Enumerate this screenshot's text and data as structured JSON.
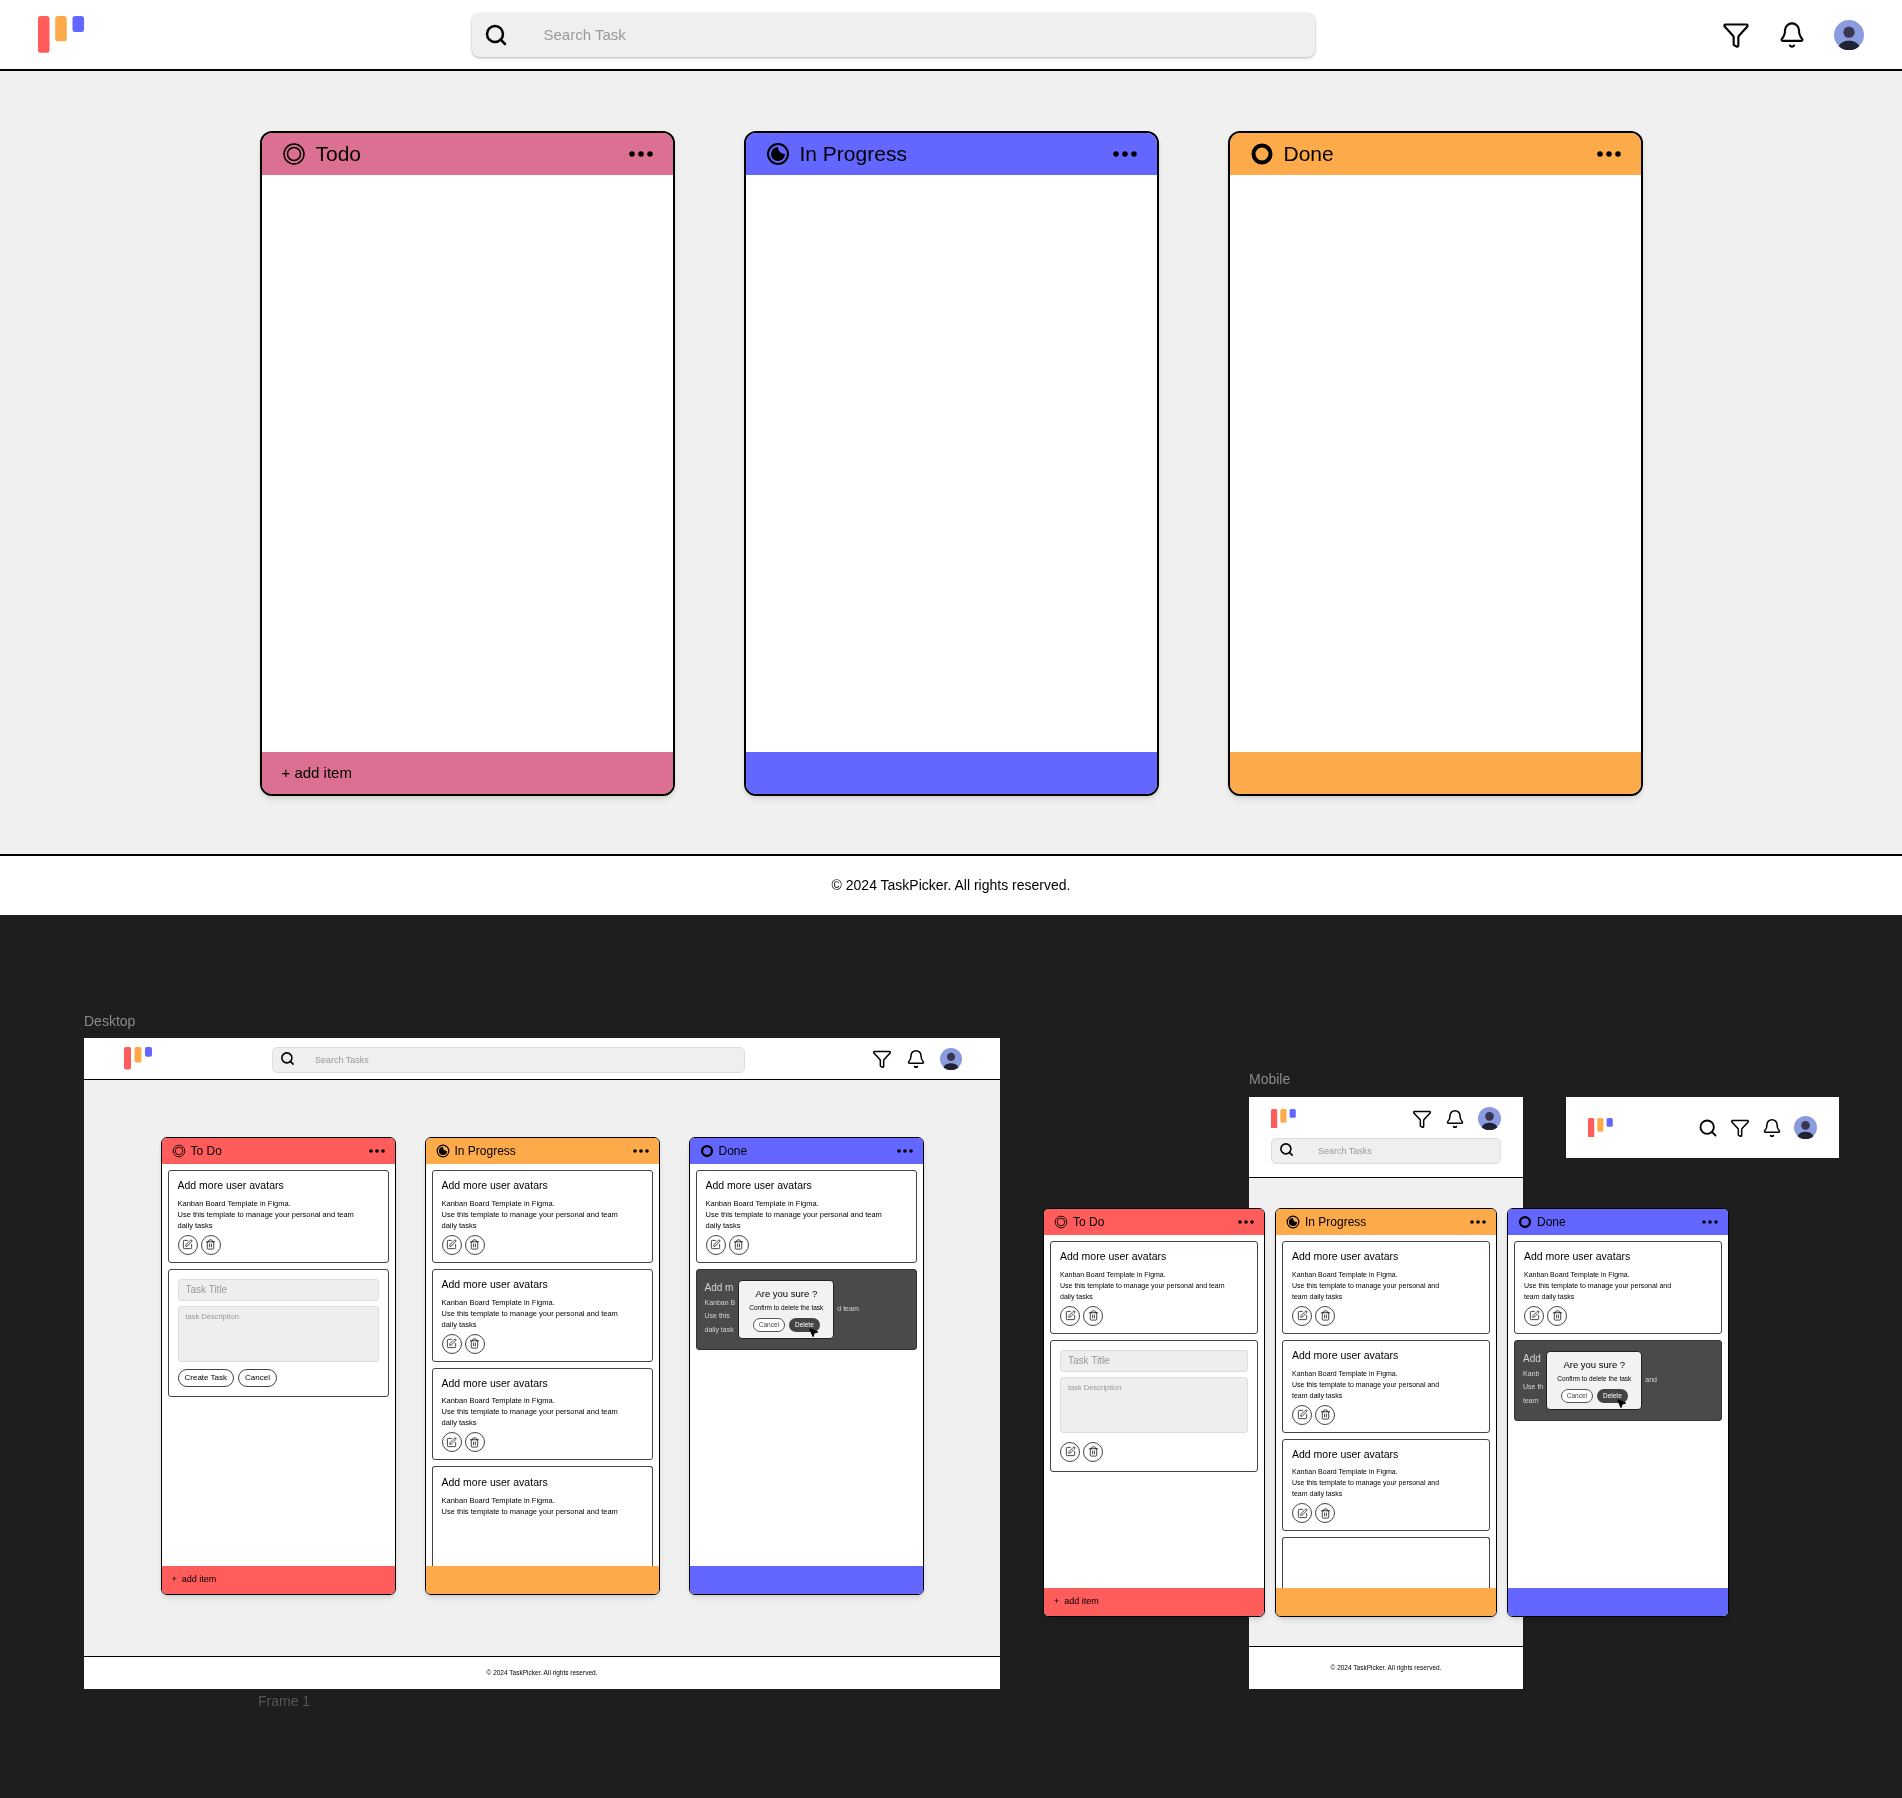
{
  "header": {
    "search_placeholder": "Search Task"
  },
  "board": {
    "columns": [
      {
        "title": "Todo",
        "kind": "ring",
        "color": "#dc7092",
        "footer_text": "+ add item"
      },
      {
        "title": "In Progress",
        "kind": "partial",
        "color": "#6366ff"
      },
      {
        "title": "Done",
        "kind": "solid",
        "color": "#fdaa4a"
      }
    ]
  },
  "footer": {
    "text": "© 2024 TaskPicker. All rights reserved."
  },
  "canvas": {
    "desktop": {
      "label": "Desktop",
      "frame_label": "Frame 1",
      "header": {
        "search_placeholder": "Search Tasks"
      },
      "footer": "© 2024 TaskPicker. All rights reserved.",
      "columns": [
        {
          "title": "To Do",
          "kind": "ring",
          "color": "#ff5c5c",
          "footer_text": "+  add item",
          "items": [
            {
              "kind": "task",
              "title": "Add more user avatars",
              "lines": [
                "Kanban Board Template in Figma.",
                "Use this template to manage your personal and team",
                "daily tasks"
              ],
              "actions": true
            },
            {
              "kind": "form",
              "title_placeholder": "Task Title",
              "description_placeholder": "task Description",
              "buttons": [
                "Create Task",
                "Cancel"
              ],
              "actions": false
            }
          ]
        },
        {
          "title": "In Progress",
          "kind": "partial",
          "color": "#fdaa4a",
          "items": [
            {
              "kind": "task",
              "title": "Add more user avatars",
              "lines": [
                "Kanban Board Template in Figma.",
                "Use this template to manage your personal and team",
                "daily tasks"
              ],
              "actions": true
            },
            {
              "kind": "task",
              "title": "Add more user avatars",
              "lines": [
                "Kanban Board Template in Figma.",
                "Use this template to manage your personal and team",
                "daily tasks"
              ],
              "actions": true
            },
            {
              "kind": "task",
              "title": "Add more user avatars",
              "lines": [
                "Kanban Board Template in Figma.",
                "Use this template to manage your personal and team",
                "daily tasks"
              ],
              "actions": true
            },
            {
              "kind": "partial",
              "title": "Add more user avatars",
              "lines": [
                "Kanban Board Template in Figma.",
                "Use this template to manage your personal and team"
              ]
            }
          ]
        },
        {
          "title": "Done",
          "kind": "solid",
          "color": "#6366ff",
          "items": [
            {
              "kind": "task",
              "title": "Add more user avatars",
              "lines": [
                "Kanban Board Template in Figma.",
                "Use this template to manage your personal and team",
                "daily tasks"
              ],
              "actions": true
            },
            {
              "kind": "confirm",
              "behind_left": [
                "Add m",
                "Kanban B",
                "Use this",
                "daily task"
              ],
              "behind_right": "d team",
              "dialog": {
                "title": "Are you sure ?",
                "message": "Confirm to delete the task",
                "cancel": "Cancel",
                "confirm": "Delete"
              }
            }
          ]
        }
      ]
    },
    "mobile": {
      "label": "Mobile",
      "header": {
        "search_placeholder": "Search Tasks"
      },
      "footer": "© 2024 TaskPicker. All rights reserved.",
      "columns": [
        {
          "title": "To Do",
          "kind": "ring",
          "color": "#ff5c5c",
          "footer_text": "+  add item",
          "items": [
            {
              "kind": "task",
              "title": "Add more user avatars",
              "lines": [
                "Kanban Board Template in Figma.",
                "Use this template to manage your personal and team",
                "daily tasks"
              ],
              "actions": true
            },
            {
              "kind": "form",
              "title_placeholder": "Task Title",
              "description_placeholder": "task Description",
              "actions": true
            }
          ]
        },
        {
          "title": "In Progress",
          "kind": "partial",
          "color": "#fdaa4a",
          "items": [
            {
              "kind": "task",
              "title": "Add more user avatars",
              "lines": [
                "Kanban Board Template in Figma.",
                "Use this template to manage your personal and",
                "team daily tasks"
              ],
              "actions": true
            },
            {
              "kind": "task",
              "title": "Add more user avatars",
              "lines": [
                "Kanban Board Template in Figma.",
                "Use this template to manage your personal and",
                "team daily tasks"
              ],
              "actions": true
            },
            {
              "kind": "task",
              "title": "Add more user avatars",
              "lines": [
                "Kanban Board Template in Figma.",
                "Use this template to manage your personal and",
                "team daily tasks"
              ],
              "actions": true
            },
            {
              "kind": "stub"
            }
          ]
        },
        {
          "title": "Done",
          "kind": "solid",
          "color": "#6366ff",
          "items": [
            {
              "kind": "task",
              "title": "Add more user avatars",
              "lines": [
                "Kanban Board Template in Figma.",
                "Use this template to manage your personal and",
                "team daily tasks"
              ],
              "actions": true
            },
            {
              "kind": "confirm",
              "behind_left": [
                "Add",
                "Kanb",
                "Use th",
                "team"
              ],
              "behind_right": "and",
              "dialog": {
                "title": "Are you sure ?",
                "message": "Confirm to delete the task",
                "cancel": "Cancel",
                "confirm": "Delete"
              }
            }
          ]
        }
      ]
    }
  }
}
